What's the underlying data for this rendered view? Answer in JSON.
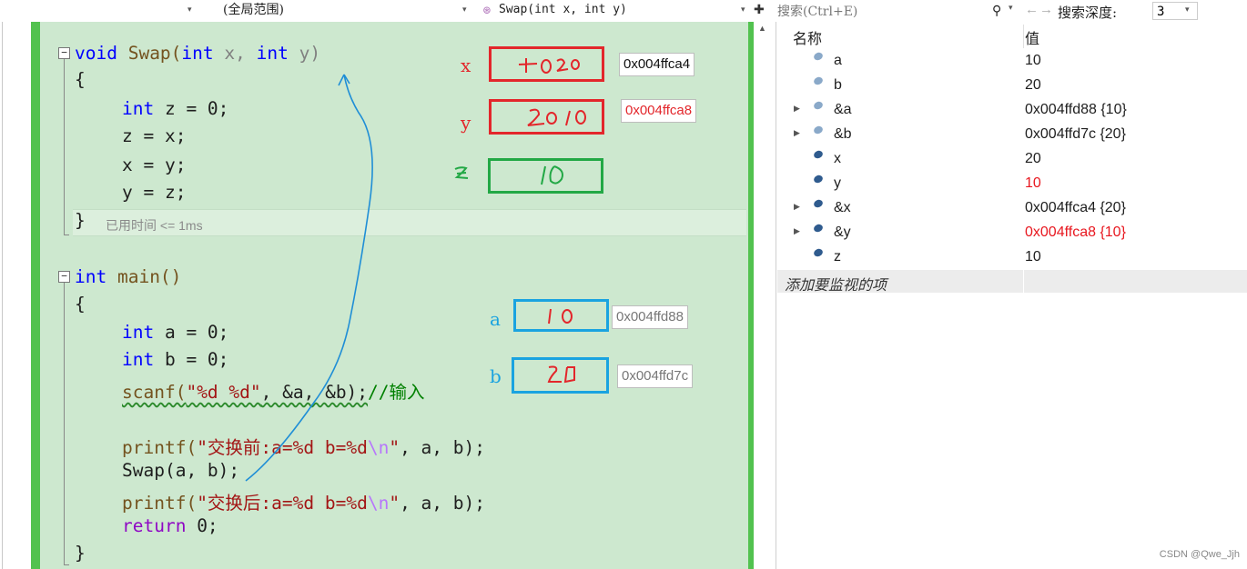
{
  "navbar": {
    "scope": "(全局范围)",
    "function": "Swap(int x, int y)",
    "split_icon": "split-icon"
  },
  "code": {
    "swap_decl": [
      "void",
      " Swap(",
      "int",
      " x, ",
      "int",
      " y)"
    ],
    "open1": "{",
    "l1": [
      "int",
      " z = 0;"
    ],
    "l2": "z = x;",
    "l3": "x = y;",
    "l4": "y = z;",
    "close1": "}",
    "elapsed": "已用时间 <= 1ms",
    "main_decl": [
      "int",
      " main()"
    ],
    "open2": "{",
    "m1": [
      "int",
      " a = 0;"
    ],
    "m2": [
      "int",
      " b = 0;"
    ],
    "m3_fn": "scanf(",
    "m3_str": "\"%d %d\"",
    "m3_rest": ", &a, &b);",
    "m3_cmt": "//输入",
    "m4_fn": "printf(",
    "m4_str": "\"交换前:a=%d b=%d",
    "m4_esc": "\\n",
    "m4_str_end": "\"",
    "m4_rest": ", a, b);",
    "m5": "Swap(a, b);",
    "m6_fn": "printf(",
    "m6_str": "\"交换后:a=%d b=%d",
    "m6_esc": "\\n",
    "m6_str_end": "\"",
    "m6_rest": ", a, b);",
    "m7_kw": "return",
    "m7_rest": " 0;",
    "close2": "}"
  },
  "annotations": {
    "x": {
      "label": "x",
      "addr": "0x004ffca4",
      "color": "#e3262b"
    },
    "y": {
      "label": "y",
      "addr": "0x004ffca8",
      "color": "#e3262b",
      "addr_color": "#e3262b"
    },
    "z": {
      "color": "#22a845"
    },
    "a": {
      "label": "a",
      "addr": "0x004ffd88",
      "color": "#1aa3e0"
    },
    "b": {
      "label": "b",
      "addr": "0x004ffd7c",
      "color": "#1aa3e0"
    }
  },
  "watch": {
    "search_placeholder": "搜索(Ctrl+E)",
    "depth_label": "搜索深度:",
    "depth_value": "3",
    "col_name": "名称",
    "col_value": "值",
    "rows": [
      {
        "name": "a",
        "value": "10",
        "expandable": false,
        "icon": "field-icon-light",
        "changed": false
      },
      {
        "name": "b",
        "value": "20",
        "expandable": false,
        "icon": "field-icon-light",
        "changed": false
      },
      {
        "name": "&a",
        "value": "0x004ffd88 {10}",
        "expandable": true,
        "icon": "field-icon-light",
        "changed": false
      },
      {
        "name": "&b",
        "value": "0x004ffd7c {20}",
        "expandable": true,
        "icon": "field-icon-light",
        "changed": false
      },
      {
        "name": "x",
        "value": "20",
        "expandable": false,
        "icon": "field-icon-dark",
        "changed": false
      },
      {
        "name": "y",
        "value": "10",
        "expandable": false,
        "icon": "field-icon-dark",
        "changed": true
      },
      {
        "name": "&x",
        "value": "0x004ffca4 {20}",
        "expandable": true,
        "icon": "field-icon-dark",
        "changed": false
      },
      {
        "name": "&y",
        "value": "0x004ffca8 {10}",
        "expandable": true,
        "icon": "field-icon-dark",
        "changed": true
      },
      {
        "name": "z",
        "value": "10",
        "expandable": false,
        "icon": "field-icon-dark",
        "changed": false
      }
    ],
    "add_item": "添加要监视的项"
  },
  "watermark": "CSDN @Qwe_Jjh"
}
